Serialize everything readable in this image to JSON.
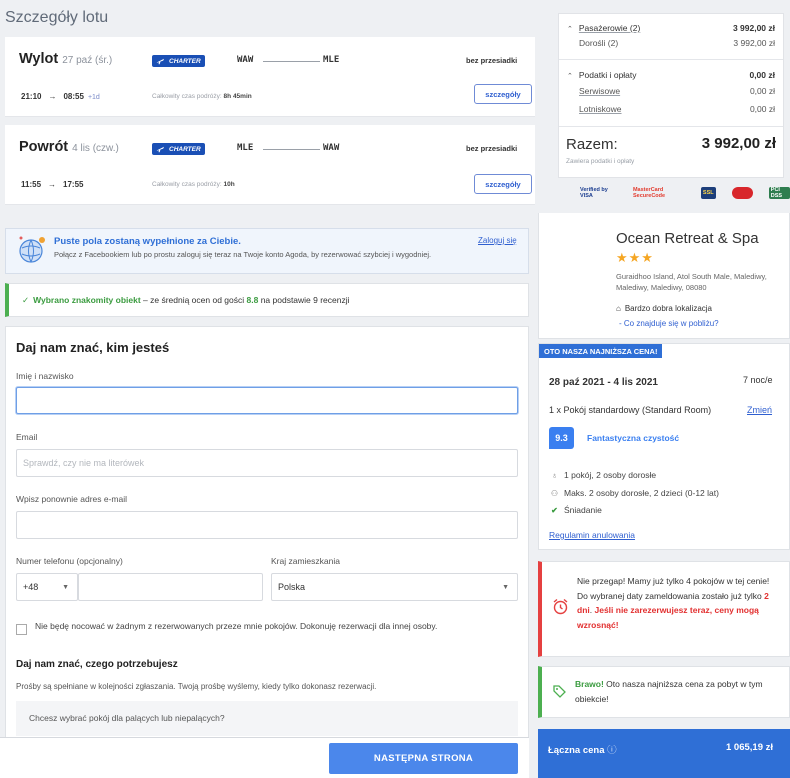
{
  "flight": {
    "title": "Szczegóły lotu",
    "charter_label": "CHARTER",
    "outbound": {
      "direction": "Wylot",
      "date": "27 paź (śr.)",
      "from": "WAW",
      "to": "MLE",
      "stops": "bez przesiadki",
      "depart": "21:10",
      "arrow": "→",
      "arrive": "08:55",
      "day_offset": "+1d",
      "duration_label": "Całkowity czas podróży:",
      "duration": "8h 45min",
      "details_label": "szczegóły"
    },
    "return": {
      "direction": "Powrót",
      "date": "4 lis (czw.)",
      "from": "MLE",
      "to": "WAW",
      "stops": "bez przesiadki",
      "depart": "11:55",
      "arrow": "→",
      "arrive": "17:55",
      "duration_label": "Całkowity czas podróży:",
      "duration": "10h",
      "details_label": "szczegóły"
    }
  },
  "price_summary": {
    "passengers_label": "Pasażerowie (2)",
    "passengers_value": "3 992,00 zł",
    "adults_label": "Dorośli (2)",
    "adults_value": "3 992,00 zł",
    "taxes_label": "Podatki i opłaty",
    "taxes_value": "0,00 zł",
    "service_label": "Serwisowe",
    "service_value": "0,00 zł",
    "airport_label": "Lotniskowe",
    "airport_value": "0,00 zł",
    "total_label": "Razem:",
    "total_value": "3 992,00 zł",
    "total_note": "Zawiera podatki i opłaty",
    "badges": [
      "Verified by VISA",
      "MasterCard SecureCode",
      "SSL",
      "",
      "PCI DSS"
    ]
  },
  "facebook_banner": {
    "title": "Puste pola zostaną wypełnione za Ciebie.",
    "subtitle": "Połącz z Facebookiem lub po prostu zaloguj się teraz na Twoje konto Agoda, by rezerwować szybciej i wygodniej.",
    "login_link": "Zaloguj się"
  },
  "good_choice": {
    "highlight": "Wybrano znakomity obiekt",
    "text_before": " – ze średnią ocen od gości ",
    "score": "8.8",
    "text_after": " na podstawie 9 recenzji"
  },
  "form": {
    "heading": "Daj nam znać, kim jesteś",
    "name_label": "Imię i nazwisko",
    "name_value": "",
    "email_label": "Email",
    "email_placeholder": "Sprawdź, czy nie ma literówek",
    "email_confirm_label": "Wpisz ponownie adres e-mail",
    "phone_label": "Numer telefonu (opcjonalny)",
    "phone_code": "+48",
    "country_label": "Kraj zamieszkania",
    "country_value": "Polska",
    "checkbox_text": "Nie będę nocować w żadnym z rezerwowanych przeze mnie pokojów. Dokonuję rezerwacji dla innej osoby.",
    "needs_heading": "Daj nam znać, czego potrzebujesz",
    "needs_sub": "Prośby są spełniane w kolejności zgłaszania. Twoją prośbę wyślemy, kiedy tylko dokonasz rezerwacji.",
    "smoking_question": "Chcesz wybrać pokój dla palących lub niepalących?",
    "next_button": "NASTĘPNA STRONA"
  },
  "hotel": {
    "name": "Ocean Retreat & Spa",
    "stars": "★★★",
    "address": "Guraidhoo Island, Atol South Male, Malediwy, Malediwy, Malediwy, 08080",
    "location_badge": "Bardzo dobra lokalizacja",
    "nearby_link": "- Co znajduje się w pobliżu?"
  },
  "booking": {
    "tag": "OTO NASZA NAJNIŻSZA CENA!",
    "dates": "28 paź 2021 - 4 lis 2021",
    "nights": "7 noc/e",
    "room": "1 x Pokój standardowy (Standard Room)",
    "change": "Zmień",
    "score": "9.3",
    "score_label": "Fantastyczna czystość",
    "occupancy": "1 pokój, 2 osoby dorosłe",
    "max": "Maks. 2 osoby dorosłe, 2 dzieci (0-12 lat)",
    "breakfast": "Śniadanie",
    "cancellation": "Regulamin anulowania"
  },
  "urgency": {
    "line1": "Nie przegap! Mamy już tylko 4 pokojów w tej cenie!",
    "line2_a": "Do wybranej daty zameldowania zostało już tylko ",
    "line2_days": "2 dni",
    "line2_b": ". ",
    "line2_warn": "Jeśli nie zarezerwujesz teraz, ceny mogą wzrosnąć!"
  },
  "bravo": {
    "highlight": "Brawo!",
    "text": " Oto nasza najniższa cena za pobyt w tym obiekcie!"
  },
  "total_card": {
    "label": "Łączna cena",
    "value": "1 065,19 zł"
  },
  "colors": {
    "accent": "#2f6fd6",
    "charter": "#1a4fb5",
    "success": "#4caf50",
    "danger": "#e54040",
    "star": "#f5a623"
  }
}
